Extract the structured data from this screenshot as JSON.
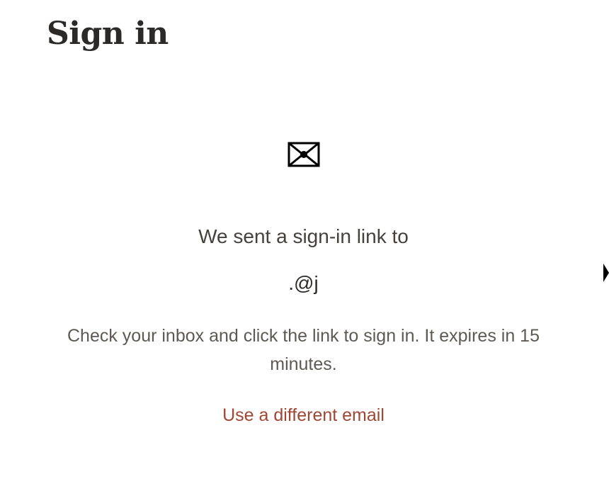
{
  "header": {
    "title": "Sign in"
  },
  "confirmation": {
    "icon": "envelope-icon",
    "sent_text": "We sent a sign-in link to",
    "email": ".@j",
    "instructions": "Check your inbox and click the link to sign in. It expires in 15 minutes.",
    "change_email_label": "Use a different email"
  },
  "colors": {
    "title": "#2b2a28",
    "body_text": "#45423d",
    "muted_text": "#5d5a55",
    "link": "#a04632"
  }
}
